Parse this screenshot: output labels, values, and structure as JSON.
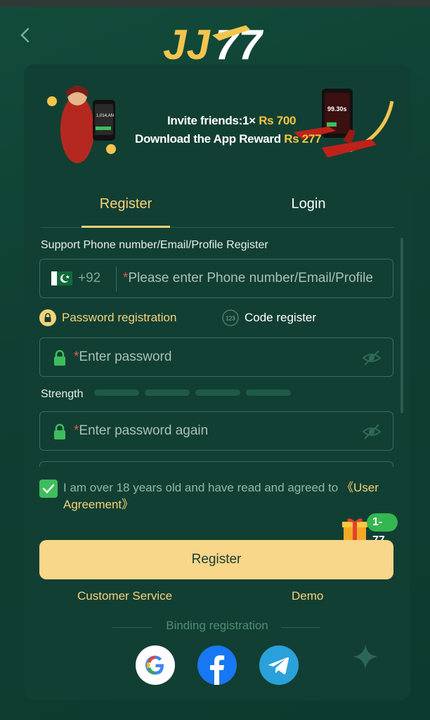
{
  "header": {
    "logo_text": "JJ77"
  },
  "banner": {
    "line1_prefix": "Invite friends:1×",
    "line1_amount": "Rs 700",
    "line2_prefix": "Download the App Reward",
    "line2_amount": "Rs 277",
    "phone_left_value": "1,014,AN",
    "phone_right_value": "99.30s"
  },
  "tabs": {
    "register": "Register",
    "login": "Login"
  },
  "form": {
    "support_label": "Support Phone number/Email/Profile Register",
    "country_code": "+92",
    "account_placeholder": "Please enter Phone number/Email/Profile",
    "password_registration": "Password registration",
    "code_register": "Code register",
    "code_icon_text": "123",
    "password_placeholder": "Enter password",
    "strength_label": "Strength",
    "password_again_placeholder": "Enter password again",
    "required_mark": "*"
  },
  "agreement": {
    "text": "I am over 18 years old and have read and agreed to ",
    "link": "《User Agreement》",
    "checked": true
  },
  "gift_badge": "1-77",
  "register_button": "Register",
  "links": {
    "customer_service": "Customer Service",
    "demo": "Demo"
  },
  "binding": {
    "label": "Binding registration"
  },
  "social": [
    "google-icon",
    "facebook-icon",
    "telegram-icon"
  ],
  "colors": {
    "accent": "#f6d27a",
    "button": "#f8d68a",
    "background": "#123f33",
    "check": "#3ebd5c"
  }
}
